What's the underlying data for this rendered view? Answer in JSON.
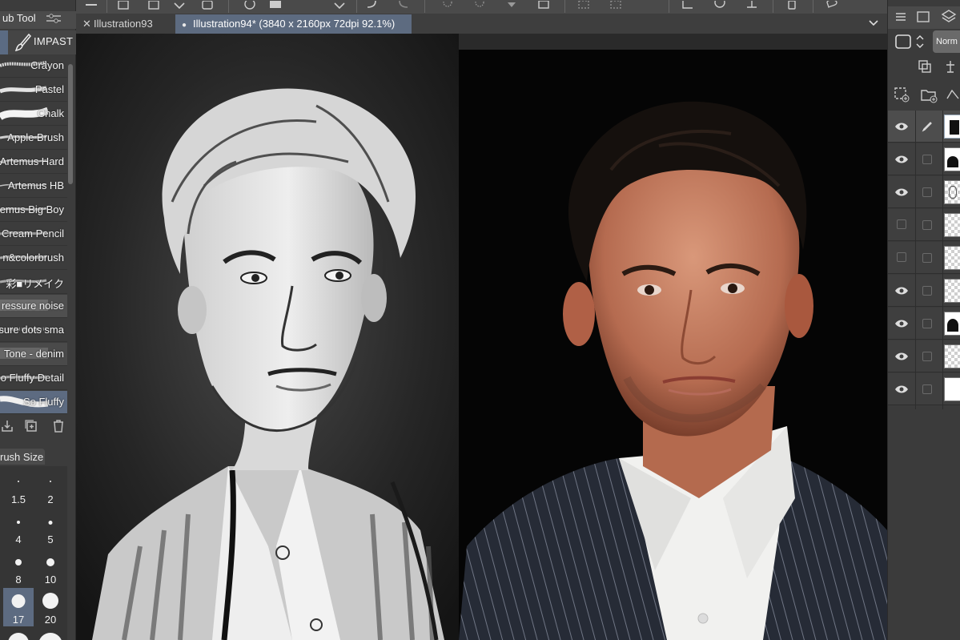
{
  "toolbar": {
    "icons": [
      "menu-icon",
      "new-file-icon",
      "open-icon",
      "save-icon",
      "undo-icon",
      "redo-icon",
      "spinner-icon",
      "transform-icon",
      "selection-icon",
      "ruler-icon",
      "device-icon",
      "speech-icon"
    ]
  },
  "tabs": [
    {
      "label": "Illustration93",
      "active": false,
      "marker": "✕"
    },
    {
      "label": "Illustration94* (3840 x 2160px 72dpi 92.1%)",
      "active": true,
      "marker": "●"
    }
  ],
  "subtool": {
    "title": "ub Tool",
    "group_label": "IMPAST",
    "brushes": [
      {
        "label": "Crayon",
        "selected": false
      },
      {
        "label": "Pastel",
        "selected": false
      },
      {
        "label": "Chalk",
        "selected": false
      },
      {
        "label": "Apple Brush",
        "selected": false
      },
      {
        "label": "Artemus Hard",
        "selected": false
      },
      {
        "label": "Artemus HB",
        "selected": false
      },
      {
        "label": "emus Big Boy",
        "selected": false
      },
      {
        "label": "Cream Pencil",
        "selected": false
      },
      {
        "label": "n&colorbrush",
        "selected": false
      },
      {
        "label": "彩■リメイク",
        "selected": false
      },
      {
        "label": "ressure noise",
        "selected": false
      },
      {
        "label": "sure dots sma",
        "selected": false
      },
      {
        "label": "Tone - denim",
        "selected": false
      },
      {
        "label": "o Fluffy Detail",
        "selected": false
      },
      {
        "label": "So Fluffy",
        "selected": true
      }
    ]
  },
  "brush_size": {
    "title": "rush Size",
    "values": [
      "1.5",
      "2",
      "4",
      "5",
      "8",
      "10",
      "17",
      "20"
    ],
    "selected": "17"
  },
  "layers": {
    "blend_mode": "Norm",
    "items": [
      {
        "visible": true,
        "selected": true,
        "thumb": "dark"
      },
      {
        "visible": true,
        "selected": false,
        "thumb": "mask"
      },
      {
        "visible": true,
        "selected": false,
        "thumb": "sketch"
      },
      {
        "visible": false,
        "selected": false,
        "thumb": "empty"
      },
      {
        "visible": false,
        "selected": false,
        "thumb": "empty"
      },
      {
        "visible": true,
        "selected": false,
        "thumb": "empty"
      },
      {
        "visible": true,
        "selected": false,
        "thumb": "mask"
      },
      {
        "visible": true,
        "selected": false,
        "thumb": "empty"
      },
      {
        "visible": true,
        "selected": false,
        "thumb": "white"
      }
    ]
  },
  "colors": {
    "accent": "#5d6b80",
    "panel": "#3c3c3c",
    "canvas_bg": "#000000"
  }
}
